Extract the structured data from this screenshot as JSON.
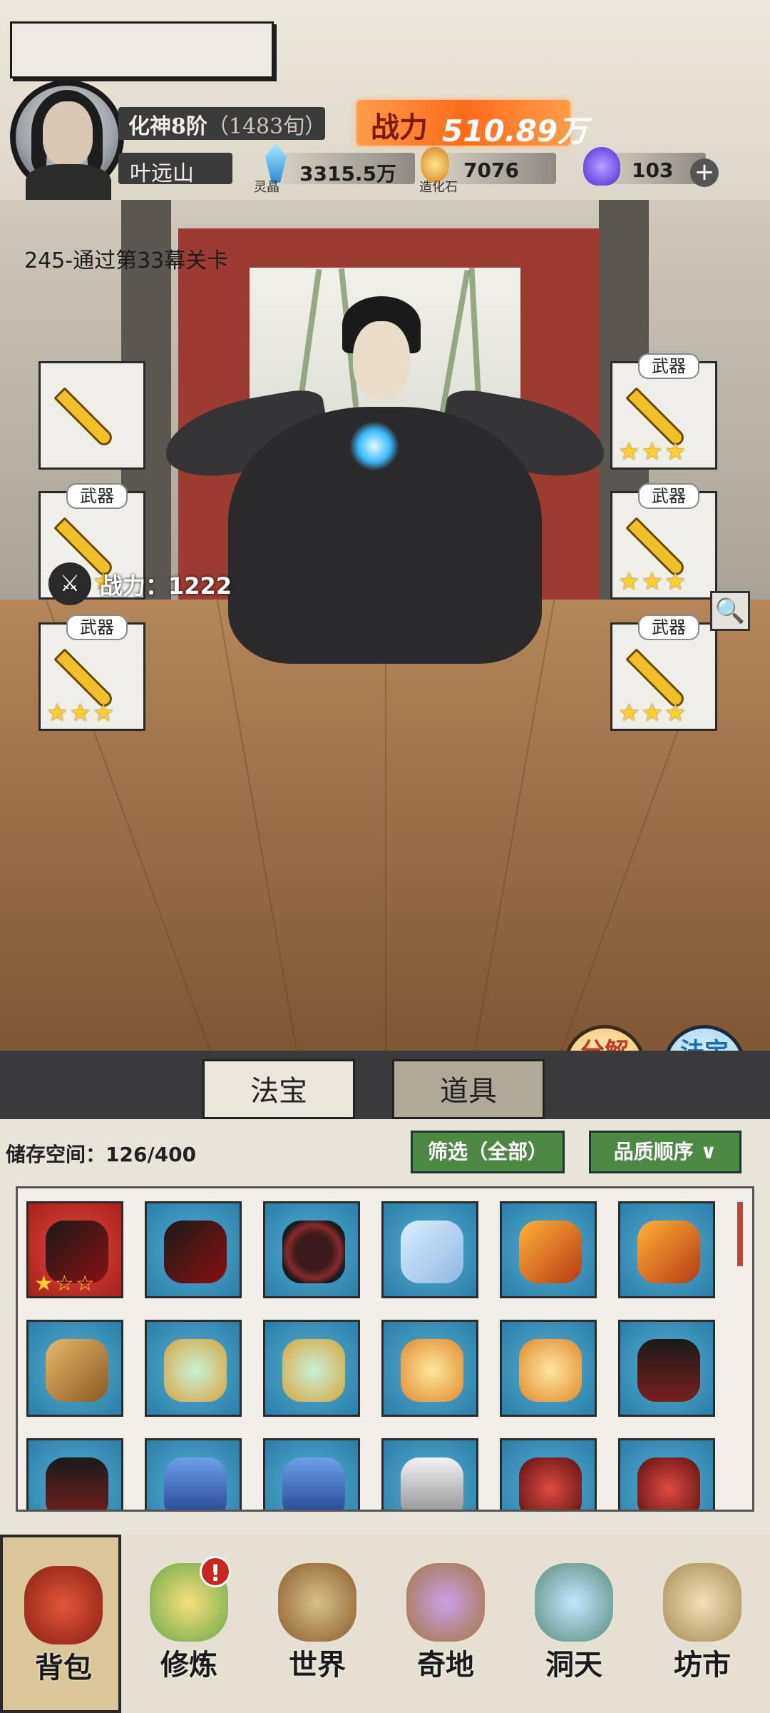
{
  "header": {
    "rank": "化神8阶",
    "age": "（1483旬）",
    "player_name": "叶远山",
    "power_label": "战力",
    "power_value": "510.89万",
    "resources": [
      {
        "icon": "blue-crystal-icon",
        "label": "灵晶",
        "value": "3315.5万"
      },
      {
        "icon": "creation-stone-icon",
        "label": "造化石",
        "value": "7076"
      },
      {
        "icon": "purple-flame-icon",
        "label": "",
        "value": "103"
      }
    ],
    "plus": "+"
  },
  "scene": {
    "stage": "245-通过第33幕关卡",
    "equip_tag": "武器",
    "stars": "★★★",
    "power_label": "战力：",
    "power_value": "1222",
    "decompose": "分解\n再造",
    "combine": "法宝\n合成"
  },
  "tabs": [
    {
      "label": "法宝",
      "active": true
    },
    {
      "label": "道具",
      "active": false
    }
  ],
  "bag": {
    "storage_label": "储存空间：",
    "storage_value": "126/400",
    "filter": "筛选（全部）",
    "sort": "品质顺序",
    "items": [
      {
        "icon": "dark-claw-blade-icon",
        "bg": "red",
        "stars": "★☆☆"
      },
      {
        "icon": "dark-claw-blade-icon",
        "bg": "blue"
      },
      {
        "icon": "spiked-wheel-icon",
        "bg": "blue"
      },
      {
        "icon": "ice-sword-icon",
        "bg": "blue"
      },
      {
        "icon": "fire-axe-icon",
        "bg": "blue"
      },
      {
        "icon": "fire-axe-icon",
        "bg": "blue"
      },
      {
        "icon": "golden-staff-icon",
        "bg": "blue"
      },
      {
        "icon": "jade-fan-icon",
        "bg": "blue"
      },
      {
        "icon": "jade-fan-icon",
        "bg": "blue"
      },
      {
        "icon": "golden-armor-icon",
        "bg": "blue"
      },
      {
        "icon": "golden-armor-icon",
        "bg": "blue"
      },
      {
        "icon": "dark-robe-icon",
        "bg": "blue"
      },
      {
        "icon": "dark-robe-icon",
        "bg": "blue"
      },
      {
        "icon": "blue-robe-icon",
        "bg": "blue"
      },
      {
        "icon": "blue-robe-icon",
        "bg": "blue"
      },
      {
        "icon": "white-robe-icon",
        "bg": "blue"
      },
      {
        "icon": "red-beast-armor-icon",
        "bg": "blue"
      },
      {
        "icon": "red-beast-armor-icon",
        "bg": "blue"
      }
    ]
  },
  "nav": [
    {
      "label": "背包",
      "icon": "bag-icon",
      "active": true
    },
    {
      "label": "修炼",
      "icon": "lotus-icon",
      "badge": "!"
    },
    {
      "label": "世界",
      "icon": "scroll-map-icon"
    },
    {
      "label": "奇地",
      "icon": "floating-island-icon"
    },
    {
      "label": "洞天",
      "icon": "portal-icon"
    },
    {
      "label": "坊市",
      "icon": "market-icon"
    }
  ],
  "colors": {
    "accent": "#ff6b1a",
    "green_button": "#4c8a44",
    "item_blue": "#2a7ea8",
    "item_red": "#a81f1a"
  }
}
